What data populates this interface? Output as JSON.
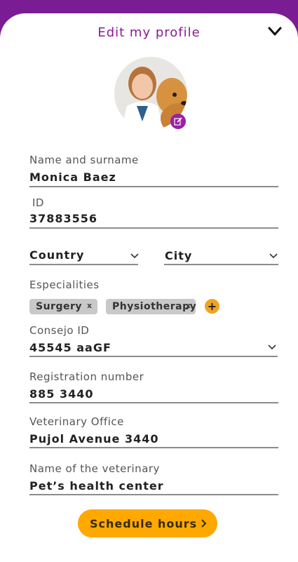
{
  "header": {
    "title": "Edit my profile",
    "close_icon": "chevron-down-icon",
    "accent": "#7a1d94"
  },
  "avatar": {
    "alt": "Veterinarian photo",
    "edit_icon": "edit-icon"
  },
  "fields": {
    "name": {
      "label": "Name and surname",
      "value": "Monica Baez"
    },
    "id": {
      "label": "ID",
      "value": "37883556"
    },
    "country": {
      "value": "Country"
    },
    "city": {
      "value": "City"
    },
    "specialities": {
      "label": "Especialities",
      "chips": [
        "Surgery",
        "Physiotherapy"
      ],
      "remove_glyph": "x",
      "add_glyph": "+"
    },
    "consejo": {
      "label": "Consejo ID",
      "value": "45545 aaGF"
    },
    "registration": {
      "label": "Registration number",
      "value": "885 3440"
    },
    "office": {
      "label": "Veterinary Office",
      "value": "Pujol Avenue 3440"
    },
    "vet_name": {
      "label": "Name of the veterinary",
      "value": "Pet’s health center"
    }
  },
  "actions": {
    "schedule_label": "Schedule hours",
    "button_color": "#ffa800"
  }
}
